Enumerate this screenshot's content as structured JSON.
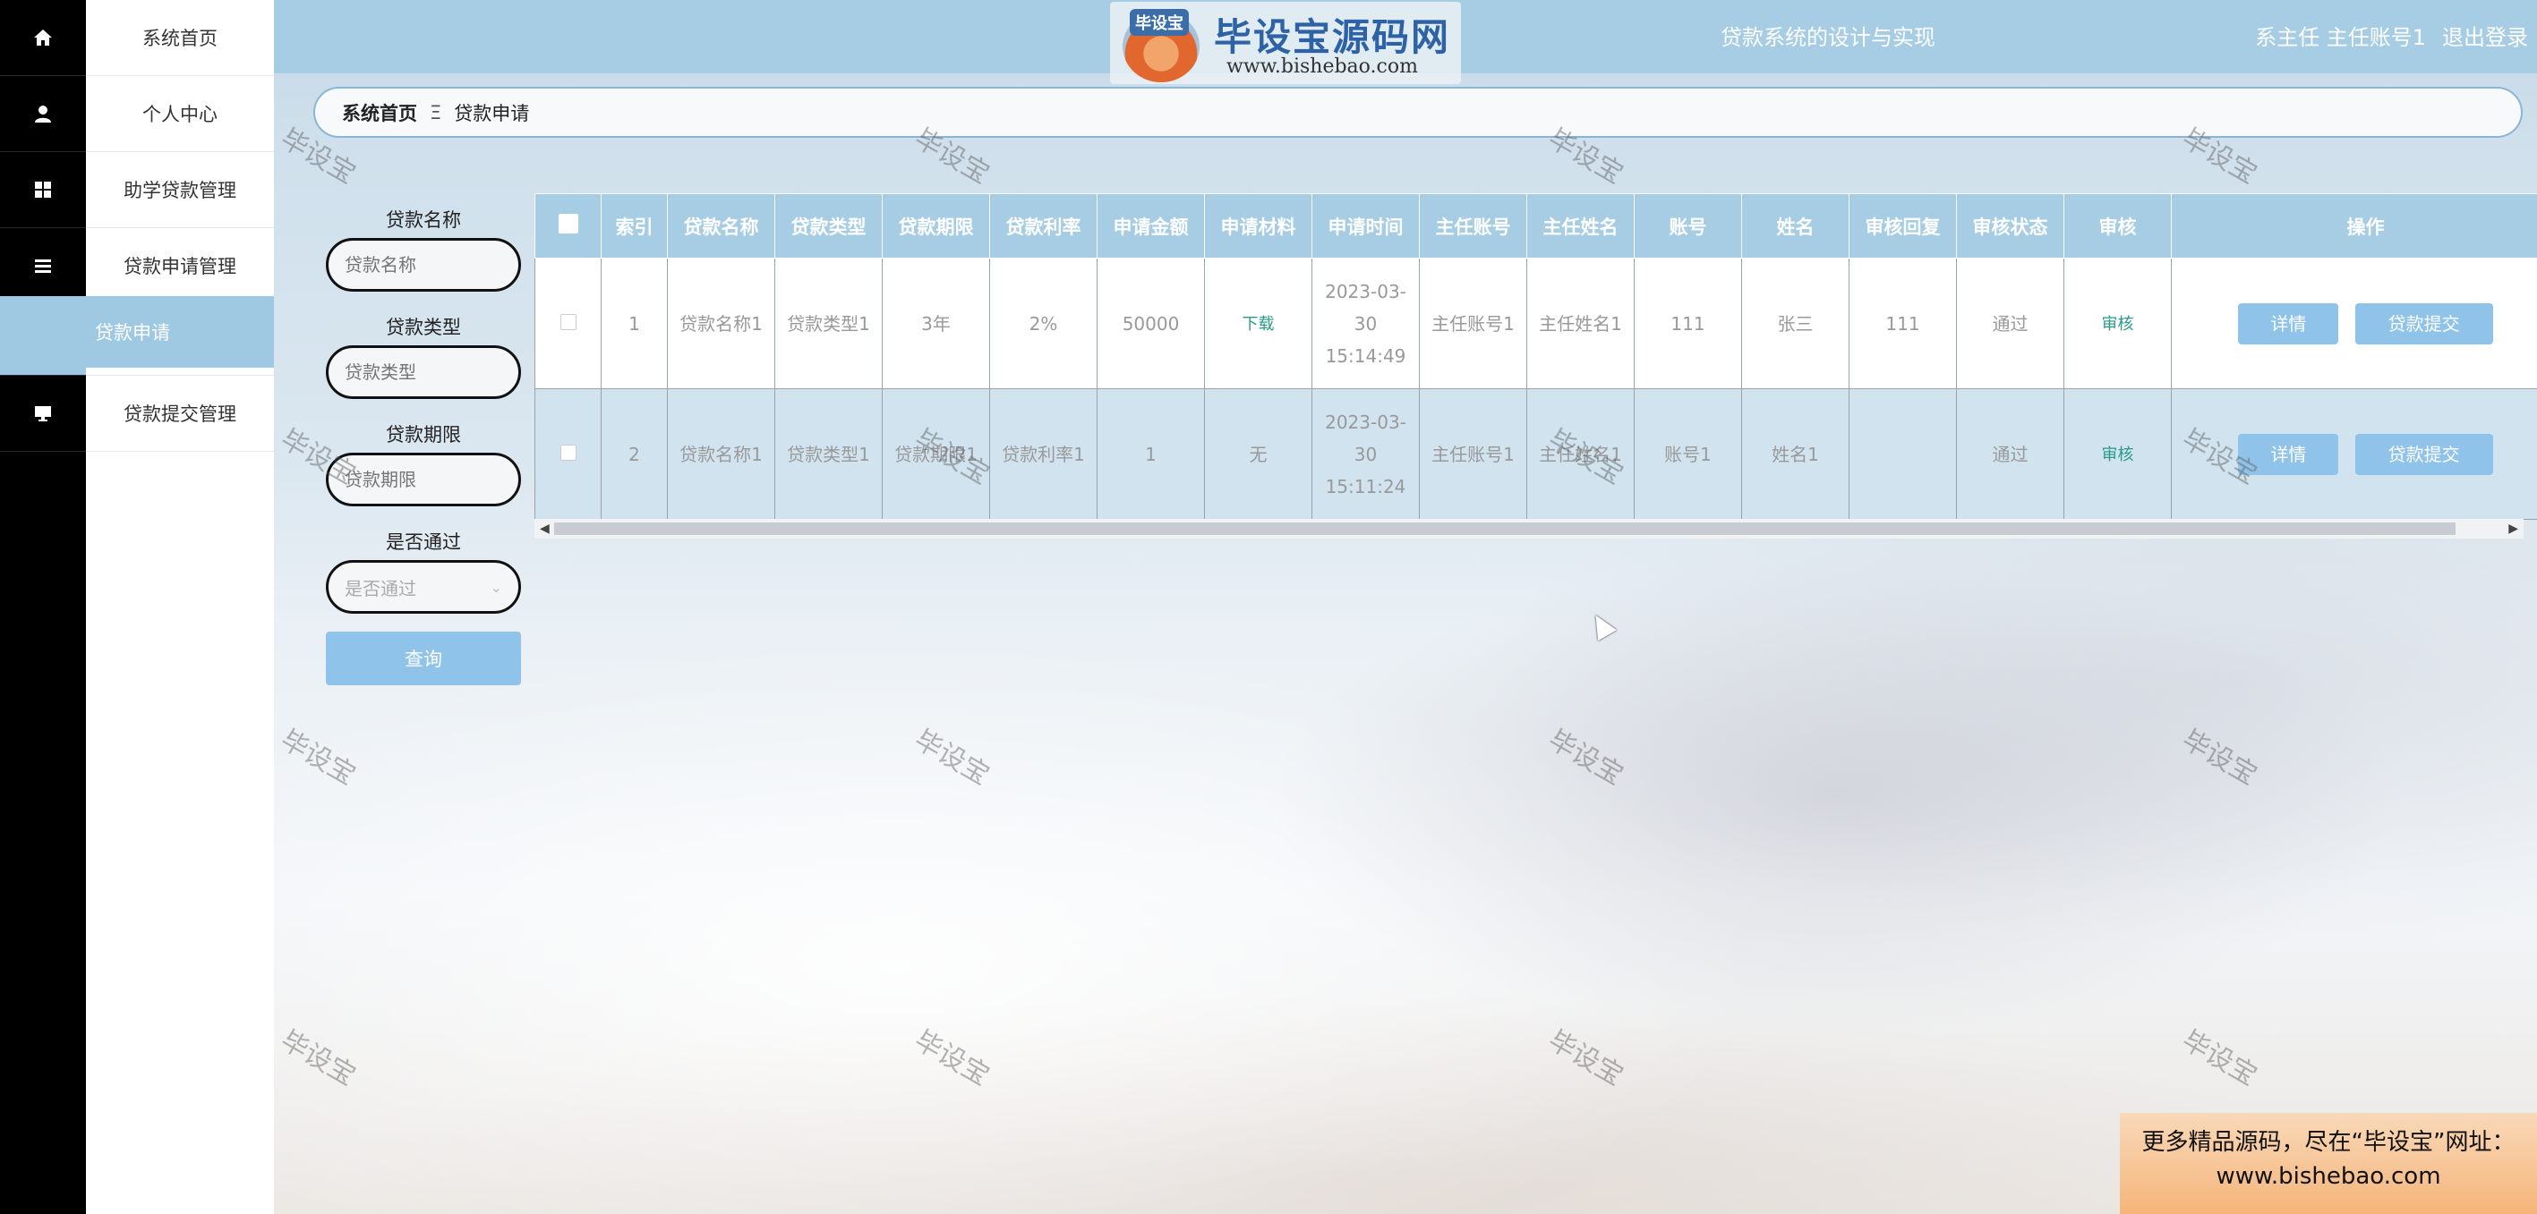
{
  "header": {
    "title": "贷款系统的设计与实现",
    "user_label": "系主任 主任账号1",
    "logout_label": "退出登录"
  },
  "logo": {
    "badge": "毕设宝",
    "name": "毕设宝源码网",
    "url": "www.bishebao.com"
  },
  "sidebar": {
    "items": [
      {
        "label": "系统首页",
        "icon": "home-icon"
      },
      {
        "label": "个人中心",
        "icon": "user-icon"
      },
      {
        "label": "助学贷款管理",
        "icon": "grid-icon"
      },
      {
        "label": "贷款申请管理",
        "icon": "list-icon"
      },
      {
        "label": "贷款申请",
        "icon": ""
      },
      {
        "label": "贷款提交管理",
        "icon": "monitor-icon"
      }
    ]
  },
  "breadcrumb": {
    "home": "系统首页",
    "separator": "Ξ",
    "current": "贷款申请"
  },
  "search": {
    "name_label": "贷款名称",
    "name_placeholder": "贷款名称",
    "type_label": "贷款类型",
    "type_placeholder": "贷款类型",
    "term_label": "贷款期限",
    "term_placeholder": "贷款期限",
    "pass_label": "是否通过",
    "pass_placeholder": "是否通过",
    "query_button": "查询"
  },
  "table": {
    "headers": [
      "索引",
      "贷款名称",
      "贷款类型",
      "贷款期限",
      "贷款利率",
      "申请金额",
      "申请材料",
      "申请时间",
      "主任账号",
      "主任姓名",
      "账号",
      "姓名",
      "审核回复",
      "审核状态",
      "审核",
      "操作"
    ],
    "rows": [
      {
        "index": "1",
        "loan_name": "贷款名称1",
        "loan_type": "贷款类型1",
        "term": "3年",
        "rate": "2%",
        "amount": "50000",
        "material": "下载",
        "apply_time": "2023-03-30 15:14:49",
        "director_account": "主任账号1",
        "director_name": "主任姓名1",
        "account": "111",
        "name": "张三",
        "reply": "111",
        "status": "通过",
        "review": "审核",
        "detail_button": "详情",
        "submit_button": "贷款提交"
      },
      {
        "index": "2",
        "loan_name": "贷款名称1",
        "loan_type": "贷款类型1",
        "term": "贷款期限1",
        "rate": "贷款利率1",
        "amount": "1",
        "material": "无",
        "apply_time": "2023-03-30 15:11:24",
        "director_account": "主任账号1",
        "director_name": "主任姓名1",
        "account": "账号1",
        "name": "姓名1",
        "reply": "",
        "status": "通过",
        "review": "审核",
        "detail_button": "详情",
        "submit_button": "贷款提交"
      }
    ]
  },
  "watermark": "毕设宝",
  "promo": {
    "line1": "更多精品源码，尽在“毕设宝”网址：",
    "line2": "www.bishebao.com"
  },
  "colors": {
    "header": "#a6cde3",
    "active_menu": "#9fc8e2",
    "button": "#8fc3ea",
    "link": "#2a9a8a"
  }
}
